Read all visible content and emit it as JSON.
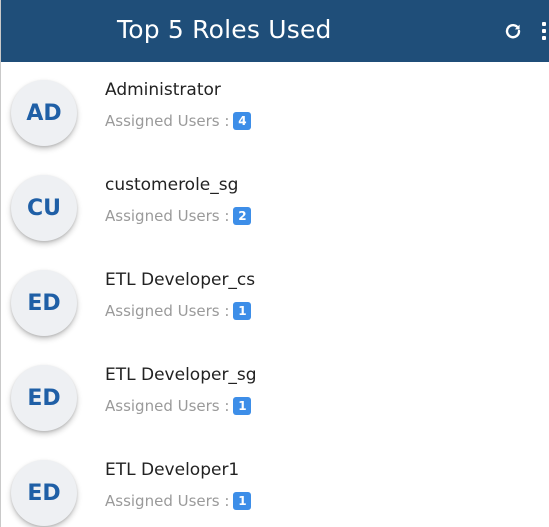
{
  "header": {
    "title": "Top 5 Roles Used",
    "refresh_icon": "refresh-icon",
    "more_icon": "more-vertical-icon",
    "background_color": "#1f4e79"
  },
  "roles": [
    {
      "initials": "AD",
      "name": "Administrator",
      "assigned_label": "Assigned Users :",
      "count": "4"
    },
    {
      "initials": "CU",
      "name": "customerole_sg",
      "assigned_label": "Assigned Users :",
      "count": "2"
    },
    {
      "initials": "ED",
      "name": "ETL Developer_cs",
      "assigned_label": "Assigned Users :",
      "count": "1"
    },
    {
      "initials": "ED",
      "name": "ETL Developer_sg",
      "assigned_label": "Assigned Users :",
      "count": "1"
    },
    {
      "initials": "ED",
      "name": "ETL Developer1",
      "assigned_label": "Assigned Users :",
      "count": "1"
    }
  ],
  "colors": {
    "avatar_text": "#1f5fa6",
    "badge": "#3d8ee8"
  }
}
